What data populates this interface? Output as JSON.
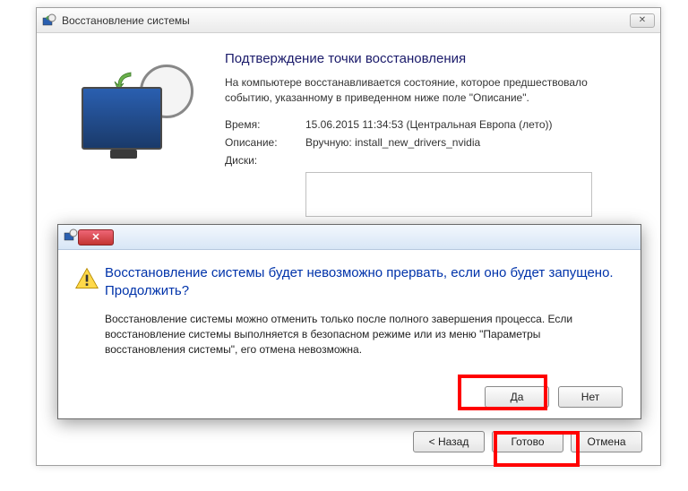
{
  "window": {
    "title": "Восстановление системы",
    "heading": "Подтверждение точки восстановления",
    "description": "На компьютере восстанавливается состояние, которое предшествовало событию, указанному в приведенном ниже поле \"Описание\".",
    "time_label": "Время:",
    "time_value": "15.06.2015 11:34:53 (Центральная Европа (лето))",
    "desc_label": "Описание:",
    "desc_value": "Вручную: install_new_drivers_nvidia",
    "disks_label": "Диски:",
    "btn_back": "< Назад",
    "btn_finish": "Готово",
    "btn_cancel": "Отмена"
  },
  "dialog": {
    "heading": "Восстановление системы будет невозможно прервать, если оно будет запущено. Продолжить?",
    "message": "Восстановление системы можно отменить только после полного завершения процесса. Если восстановление системы выполняется в безопасном режиме или из меню \"Параметры восстановления системы\", его отмена невозможна.",
    "btn_yes": "Да",
    "btn_no": "Нет"
  }
}
